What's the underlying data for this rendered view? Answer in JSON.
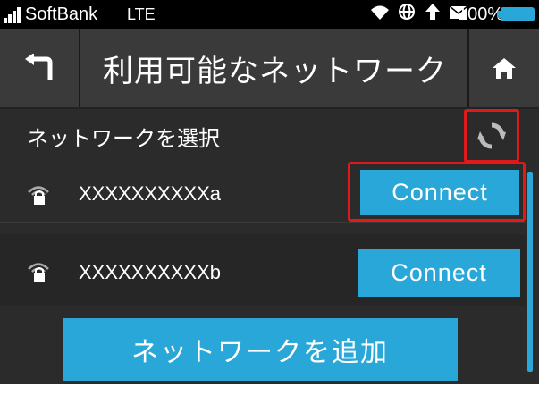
{
  "status_bar": {
    "carrier": "SoftBank",
    "network": "LTE",
    "icons": [
      "wifi-icon",
      "globe-icon",
      "upload-icon",
      "mail-icon"
    ],
    "battery": "100%"
  },
  "header": {
    "title": "利用可能なネットワーク",
    "back_icon": "back-arrow-icon",
    "home_icon": "home-icon"
  },
  "section": {
    "label": "ネットワークを選択",
    "refresh_icon": "refresh-icon"
  },
  "networks": [
    {
      "ssid": "XXXXXXXXXXa",
      "button": "Connect",
      "icon": "wifi-lock-icon"
    },
    {
      "ssid": "XXXXXXXXXXb",
      "button": "Connect",
      "icon": "wifi-lock-icon"
    }
  ],
  "add_button": "ネットワークを追加",
  "colors": {
    "accent": "#2aa7d9",
    "highlight": "#e0191a",
    "background": "#2b2b2b",
    "header": "#3a3a3a"
  }
}
